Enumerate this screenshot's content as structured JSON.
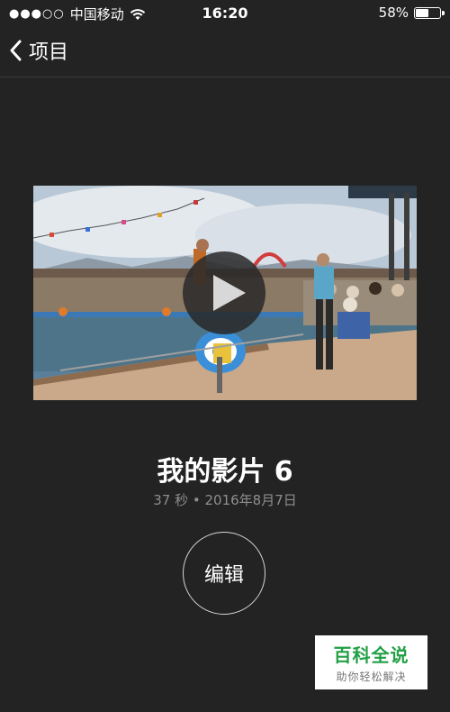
{
  "status_bar": {
    "signal": "●●●○○",
    "carrier": "中国移动",
    "time": "16:20",
    "battery_text": "58%",
    "battery_level": 0.58,
    "wifi_icon": "wifi-icon"
  },
  "nav": {
    "back_label": "项目",
    "back_icon": "chevron-left-icon"
  },
  "video": {
    "play_icon": "play-icon"
  },
  "project": {
    "title": "我的影片 6",
    "meta": "37 秒 • 2016年8月7日"
  },
  "actions": {
    "edit_label": "编辑"
  },
  "watermark": {
    "title": "百科全说",
    "subtitle": "助你轻松解决"
  },
  "colors": {
    "background": "#232323",
    "meta_text": "#8e8e8e",
    "watermark_green": "#22a046"
  }
}
